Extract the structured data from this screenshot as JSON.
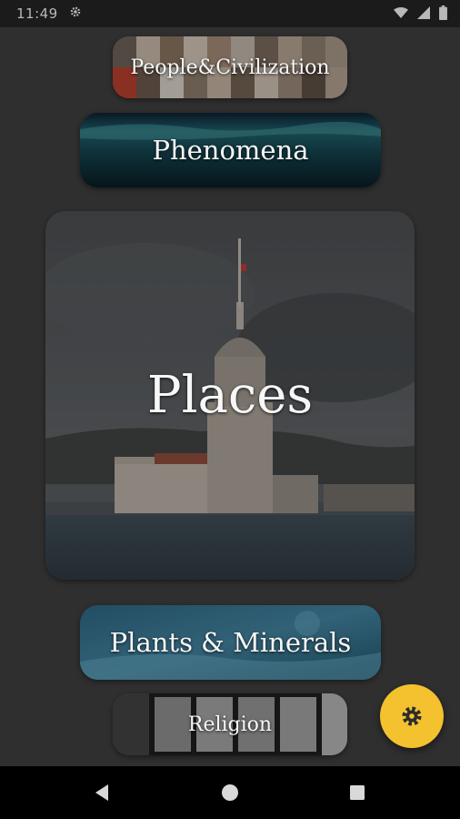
{
  "status_bar": {
    "time": "11:49",
    "icons": [
      "settings-icon",
      "wifi-icon",
      "signal-icon",
      "battery-icon"
    ]
  },
  "categories": [
    {
      "label": "People&Civilization"
    },
    {
      "label": "Phenomena"
    },
    {
      "label": "Places"
    },
    {
      "label": "Plants & Minerals"
    },
    {
      "label": "Religion"
    }
  ],
  "fab": {
    "icon": "settings-icon"
  },
  "nav_bar": {
    "icons": [
      "back-icon",
      "home-icon",
      "recents-icon"
    ]
  },
  "colors": {
    "background": "#2f2f2f",
    "fab": "#f4c12f",
    "status_bar": "#1b1b1b",
    "nav_bar": "#000000"
  }
}
